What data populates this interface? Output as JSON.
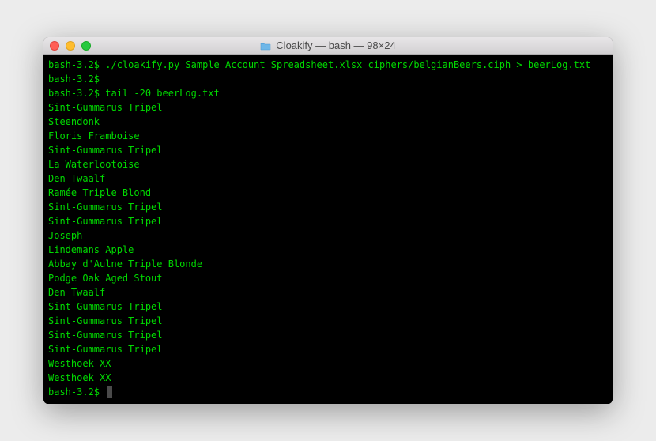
{
  "window": {
    "title": "Cloakify — bash — 98×24"
  },
  "terminal": {
    "prompt": "bash-3.2$",
    "lines": [
      {
        "type": "command",
        "text": "./cloakify.py Sample_Account_Spreadsheet.xlsx ciphers/belgianBeers.ciph > beerLog.txt"
      },
      {
        "type": "command",
        "text": ""
      },
      {
        "type": "command",
        "text": "tail -20 beerLog.txt"
      },
      {
        "type": "output",
        "text": "Sint-Gummarus Tripel"
      },
      {
        "type": "output",
        "text": "Steendonk"
      },
      {
        "type": "output",
        "text": "Floris Framboise"
      },
      {
        "type": "output",
        "text": "Sint-Gummarus Tripel"
      },
      {
        "type": "output",
        "text": "La Waterlootoise"
      },
      {
        "type": "output",
        "text": "Den Twaalf"
      },
      {
        "type": "output",
        "text": "Ramée Triple Blond"
      },
      {
        "type": "output",
        "text": "Sint-Gummarus Tripel"
      },
      {
        "type": "output",
        "text": "Sint-Gummarus Tripel"
      },
      {
        "type": "output",
        "text": "Joseph"
      },
      {
        "type": "output",
        "text": "Lindemans Apple"
      },
      {
        "type": "output",
        "text": "Abbay d'Aulne Triple Blonde"
      },
      {
        "type": "output",
        "text": "Podge Oak Aged Stout"
      },
      {
        "type": "output",
        "text": "Den Twaalf"
      },
      {
        "type": "output",
        "text": "Sint-Gummarus Tripel"
      },
      {
        "type": "output",
        "text": "Sint-Gummarus Tripel"
      },
      {
        "type": "output",
        "text": "Sint-Gummarus Tripel"
      },
      {
        "type": "output",
        "text": "Sint-Gummarus Tripel"
      },
      {
        "type": "output",
        "text": "Westhoek XX"
      },
      {
        "type": "output",
        "text": "Westhoek XX"
      },
      {
        "type": "prompt-only",
        "text": ""
      }
    ]
  }
}
